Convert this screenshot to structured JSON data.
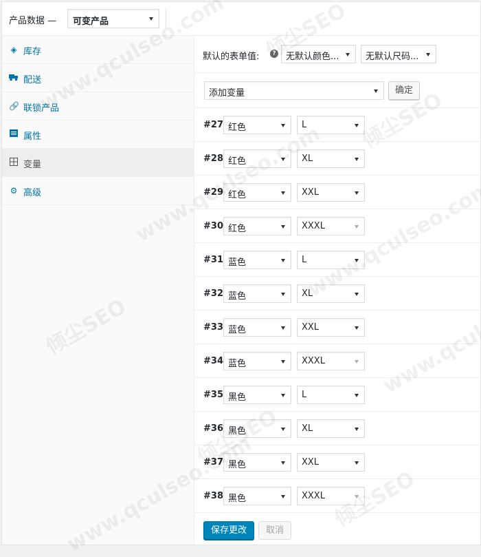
{
  "header": {
    "title": "产品数据 —",
    "product_type": "可变产品"
  },
  "sidebar": {
    "items": [
      {
        "label": "库存",
        "icon": "inventory-icon"
      },
      {
        "label": "配送",
        "icon": "truck-icon"
      },
      {
        "label": "联锁产品",
        "icon": "link-icon"
      },
      {
        "label": "属性",
        "icon": "list-icon"
      },
      {
        "label": "变量",
        "icon": "grid-icon",
        "active": true
      },
      {
        "label": "高级",
        "icon": "gear-icon"
      }
    ]
  },
  "defaults": {
    "label": "默认的表单值:",
    "color_select": "无默认颜色...",
    "size_select": "无默认尺码..."
  },
  "add": {
    "select": "添加变量",
    "confirm": "确定"
  },
  "variations": [
    {
      "id": "#27",
      "color": "红色",
      "size": "L"
    },
    {
      "id": "#28",
      "color": "红色",
      "size": "XL"
    },
    {
      "id": "#29",
      "color": "红色",
      "size": "XXL"
    },
    {
      "id": "#30",
      "color": "红色",
      "size": "XXXL"
    },
    {
      "id": "#31",
      "color": "蓝色",
      "size": "L"
    },
    {
      "id": "#32",
      "color": "蓝色",
      "size": "XL"
    },
    {
      "id": "#33",
      "color": "蓝色",
      "size": "XXL"
    },
    {
      "id": "#34",
      "color": "蓝色",
      "size": "XXXL"
    },
    {
      "id": "#35",
      "color": "黑色",
      "size": "L"
    },
    {
      "id": "#36",
      "color": "黑色",
      "size": "XL"
    },
    {
      "id": "#37",
      "color": "黑色",
      "size": "XXL"
    },
    {
      "id": "#38",
      "color": "黑色",
      "size": "XXXL"
    }
  ],
  "footer": {
    "save": "保存更改",
    "cancel": "取消"
  },
  "watermark": {
    "brand": "倾尘SEO",
    "url": "www.qculseo.com"
  },
  "colors": {
    "link": "#0073aa",
    "primary": "#0085ba",
    "border": "#eeeeee"
  }
}
